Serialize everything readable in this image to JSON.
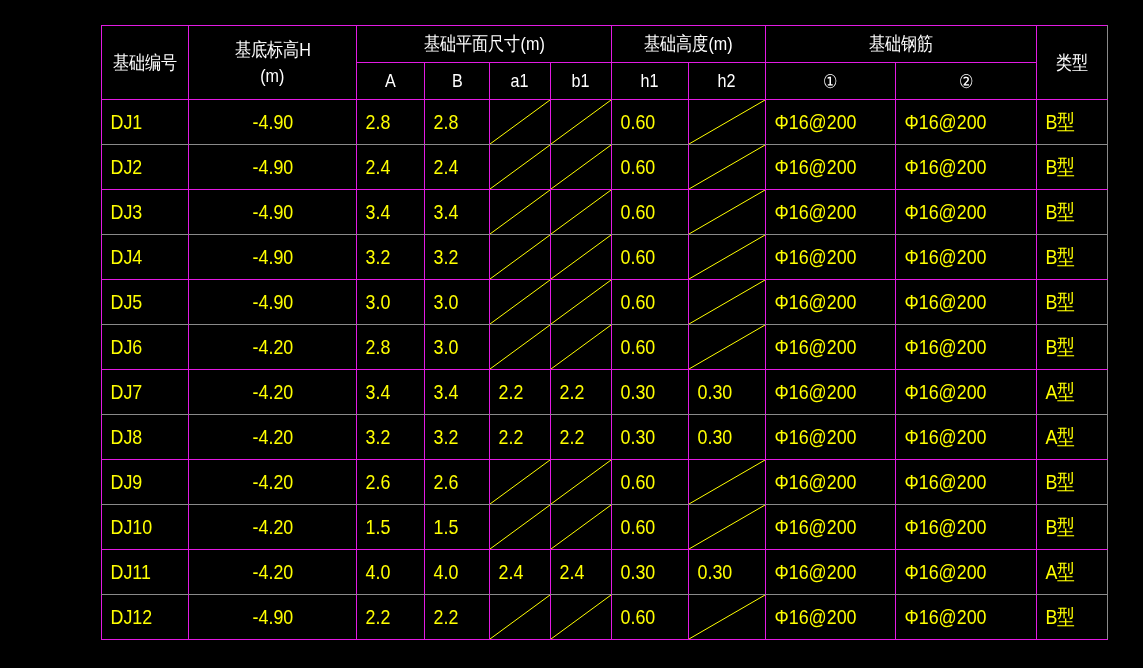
{
  "table": {
    "header_top": [
      {
        "lines": [
          "基础编号"
        ],
        "rowspan": 2
      },
      {
        "lines": [
          "基底标高H",
          "(m)"
        ],
        "rowspan": 2
      },
      {
        "lines": [
          "基础平面尺寸(m)"
        ],
        "colspan": 4
      },
      {
        "lines": [
          "基础高度(m)"
        ],
        "colspan": 2
      },
      {
        "lines": [
          "基础钢筋"
        ],
        "colspan": 2
      },
      {
        "lines": [
          "类型"
        ],
        "rowspan": 2
      }
    ],
    "header_sub": [
      "A",
      "B",
      "a1",
      "b1",
      "h1",
      "h2",
      "①",
      "②"
    ],
    "rows": [
      {
        "cells": [
          {
            "kind": "text",
            "text": "DJ1"
          },
          {
            "kind": "text",
            "text": "-4.90"
          },
          {
            "kind": "text",
            "text": "2.8"
          },
          {
            "kind": "text",
            "text": "2.8"
          },
          {
            "kind": "slash"
          },
          {
            "kind": "slash"
          },
          {
            "kind": "text",
            "text": "0.60"
          },
          {
            "kind": "slash"
          },
          {
            "kind": "text",
            "text": "Φ16@200"
          },
          {
            "kind": "text",
            "text": "Φ16@200"
          },
          {
            "kind": "text",
            "text": "B型"
          }
        ]
      },
      {
        "cells": [
          {
            "kind": "text",
            "text": "DJ2"
          },
          {
            "kind": "text",
            "text": "-4.90"
          },
          {
            "kind": "text",
            "text": "2.4"
          },
          {
            "kind": "text",
            "text": "2.4"
          },
          {
            "kind": "slash"
          },
          {
            "kind": "slash"
          },
          {
            "kind": "text",
            "text": "0.60"
          },
          {
            "kind": "slash"
          },
          {
            "kind": "text",
            "text": "Φ16@200"
          },
          {
            "kind": "text",
            "text": "Φ16@200"
          },
          {
            "kind": "text",
            "text": "B型"
          }
        ]
      },
      {
        "cells": [
          {
            "kind": "text",
            "text": "DJ3"
          },
          {
            "kind": "text",
            "text": "-4.90"
          },
          {
            "kind": "text",
            "text": "3.4"
          },
          {
            "kind": "text",
            "text": "3.4"
          },
          {
            "kind": "slash"
          },
          {
            "kind": "slash"
          },
          {
            "kind": "text",
            "text": "0.60"
          },
          {
            "kind": "slash"
          },
          {
            "kind": "text",
            "text": "Φ16@200"
          },
          {
            "kind": "text",
            "text": "Φ16@200"
          },
          {
            "kind": "text",
            "text": "B型"
          }
        ]
      },
      {
        "cells": [
          {
            "kind": "text",
            "text": "DJ4"
          },
          {
            "kind": "text",
            "text": "-4.90"
          },
          {
            "kind": "text",
            "text": "3.2"
          },
          {
            "kind": "text",
            "text": "3.2"
          },
          {
            "kind": "slash"
          },
          {
            "kind": "slash"
          },
          {
            "kind": "text",
            "text": "0.60"
          },
          {
            "kind": "slash"
          },
          {
            "kind": "text",
            "text": "Φ16@200"
          },
          {
            "kind": "text",
            "text": "Φ16@200"
          },
          {
            "kind": "text",
            "text": "B型"
          }
        ]
      },
      {
        "cells": [
          {
            "kind": "text",
            "text": "DJ5"
          },
          {
            "kind": "text",
            "text": "-4.90"
          },
          {
            "kind": "text",
            "text": "3.0"
          },
          {
            "kind": "text",
            "text": "3.0"
          },
          {
            "kind": "slash"
          },
          {
            "kind": "slash"
          },
          {
            "kind": "text",
            "text": "0.60"
          },
          {
            "kind": "slash"
          },
          {
            "kind": "text",
            "text": "Φ16@200"
          },
          {
            "kind": "text",
            "text": "Φ16@200"
          },
          {
            "kind": "text",
            "text": "B型"
          }
        ]
      },
      {
        "cells": [
          {
            "kind": "text",
            "text": "DJ6"
          },
          {
            "kind": "text",
            "text": "-4.20"
          },
          {
            "kind": "text",
            "text": "2.8"
          },
          {
            "kind": "text",
            "text": "3.0"
          },
          {
            "kind": "slash"
          },
          {
            "kind": "slash"
          },
          {
            "kind": "text",
            "text": "0.60"
          },
          {
            "kind": "slash"
          },
          {
            "kind": "text",
            "text": "Φ16@200"
          },
          {
            "kind": "text",
            "text": "Φ16@200"
          },
          {
            "kind": "text",
            "text": "B型"
          }
        ]
      },
      {
        "cells": [
          {
            "kind": "text",
            "text": "DJ7"
          },
          {
            "kind": "text",
            "text": "-4.20"
          },
          {
            "kind": "text",
            "text": "3.4"
          },
          {
            "kind": "text",
            "text": "3.4"
          },
          {
            "kind": "text",
            "text": "2.2"
          },
          {
            "kind": "text",
            "text": "2.2"
          },
          {
            "kind": "text",
            "text": "0.30"
          },
          {
            "kind": "text",
            "text": "0.30"
          },
          {
            "kind": "text",
            "text": "Φ16@200"
          },
          {
            "kind": "text",
            "text": "Φ16@200"
          },
          {
            "kind": "text",
            "text": "A型"
          }
        ]
      },
      {
        "cells": [
          {
            "kind": "text",
            "text": "DJ8"
          },
          {
            "kind": "text",
            "text": "-4.20"
          },
          {
            "kind": "text",
            "text": "3.2"
          },
          {
            "kind": "text",
            "text": "3.2"
          },
          {
            "kind": "text",
            "text": "2.2"
          },
          {
            "kind": "text",
            "text": "2.2"
          },
          {
            "kind": "text",
            "text": "0.30"
          },
          {
            "kind": "text",
            "text": "0.30"
          },
          {
            "kind": "text",
            "text": "Φ16@200"
          },
          {
            "kind": "text",
            "text": "Φ16@200"
          },
          {
            "kind": "text",
            "text": "A型"
          }
        ]
      },
      {
        "cells": [
          {
            "kind": "text",
            "text": "DJ9"
          },
          {
            "kind": "text",
            "text": "-4.20"
          },
          {
            "kind": "text",
            "text": "2.6"
          },
          {
            "kind": "text",
            "text": "2.6"
          },
          {
            "kind": "slash"
          },
          {
            "kind": "slash"
          },
          {
            "kind": "text",
            "text": "0.60"
          },
          {
            "kind": "slash"
          },
          {
            "kind": "text",
            "text": "Φ16@200"
          },
          {
            "kind": "text",
            "text": "Φ16@200"
          },
          {
            "kind": "text",
            "text": "B型"
          }
        ]
      },
      {
        "cells": [
          {
            "kind": "text",
            "text": "DJ10"
          },
          {
            "kind": "text",
            "text": "-4.20"
          },
          {
            "kind": "text",
            "text": "1.5"
          },
          {
            "kind": "text",
            "text": "1.5"
          },
          {
            "kind": "slash"
          },
          {
            "kind": "slash"
          },
          {
            "kind": "text",
            "text": "0.60"
          },
          {
            "kind": "slash"
          },
          {
            "kind": "text",
            "text": "Φ16@200"
          },
          {
            "kind": "text",
            "text": "Φ16@200"
          },
          {
            "kind": "text",
            "text": "B型"
          }
        ]
      },
      {
        "cells": [
          {
            "kind": "text",
            "text": "DJ11"
          },
          {
            "kind": "text",
            "text": "-4.20"
          },
          {
            "kind": "text",
            "text": "4.0"
          },
          {
            "kind": "text",
            "text": "4.0"
          },
          {
            "kind": "text",
            "text": "2.4"
          },
          {
            "kind": "text",
            "text": "2.4"
          },
          {
            "kind": "text",
            "text": "0.30"
          },
          {
            "kind": "text",
            "text": "0.30"
          },
          {
            "kind": "text",
            "text": "Φ16@200"
          },
          {
            "kind": "text",
            "text": "Φ16@200"
          },
          {
            "kind": "text",
            "text": "A型"
          }
        ]
      },
      {
        "cells": [
          {
            "kind": "text",
            "text": "DJ12"
          },
          {
            "kind": "text",
            "text": "-4.90"
          },
          {
            "kind": "text",
            "text": "2.2"
          },
          {
            "kind": "text",
            "text": "2.2"
          },
          {
            "kind": "slash"
          },
          {
            "kind": "slash"
          },
          {
            "kind": "text",
            "text": "0.60"
          },
          {
            "kind": "slash"
          },
          {
            "kind": "text",
            "text": "Φ16@200"
          },
          {
            "kind": "text",
            "text": "Φ16@200"
          },
          {
            "kind": "text",
            "text": "B型"
          }
        ]
      }
    ]
  }
}
